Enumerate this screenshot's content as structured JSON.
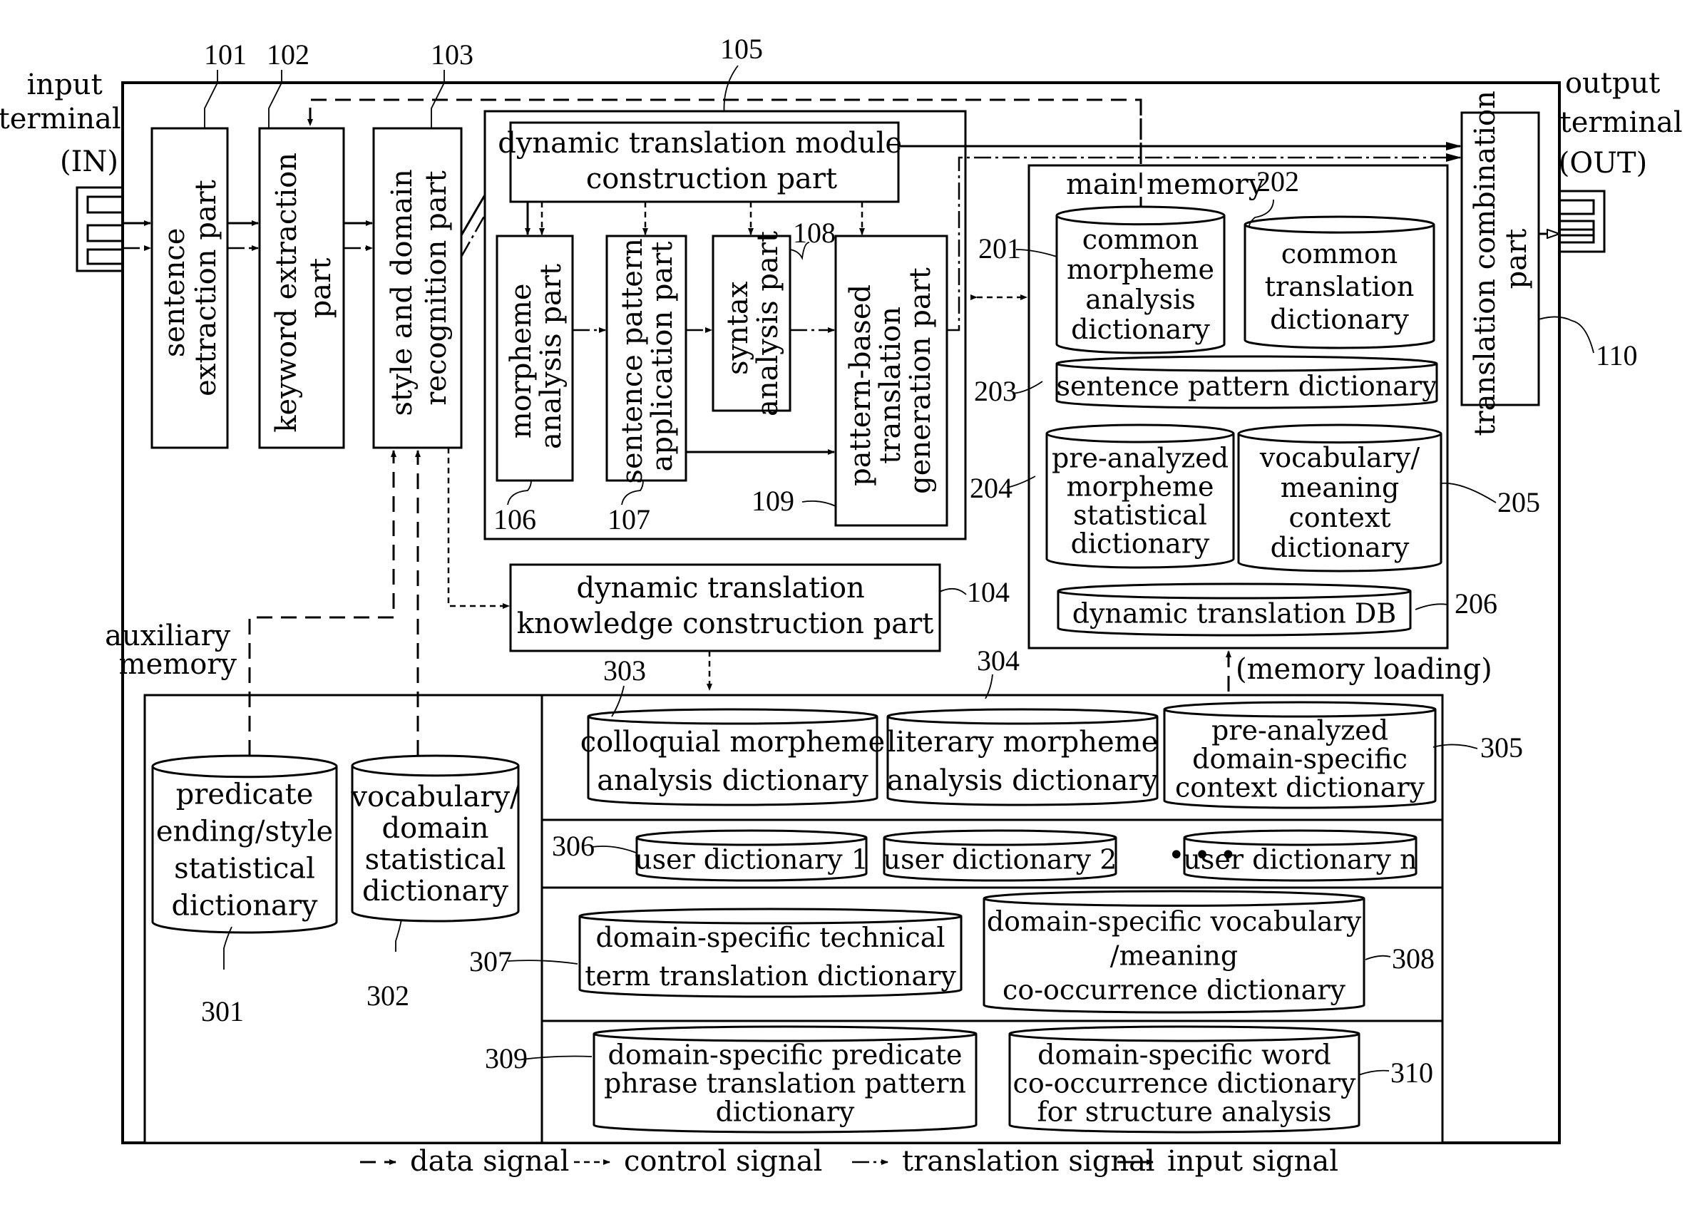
{
  "terminals": {
    "input": [
      "input",
      "terminal",
      "(IN)"
    ],
    "output": [
      "output",
      "terminal",
      "(OUT)"
    ]
  },
  "ref_numbers": {
    "r101": "101",
    "r102": "102",
    "r103": "103",
    "r104": "104",
    "r105": "105",
    "r106": "106",
    "r107": "107",
    "r108": "108",
    "r109": "109",
    "r110": "110",
    "r201": "201",
    "r202": "202",
    "r203": "203",
    "r204": "204",
    "r205": "205",
    "r206": "206",
    "r301": "301",
    "r302": "302",
    "r303": "303",
    "r304": "304",
    "r305": "305",
    "r306": "306",
    "r307": "307",
    "r308": "308",
    "r309": "309",
    "r310": "310"
  },
  "blocks": {
    "sentence_extraction": [
      "sentence",
      "extraction part"
    ],
    "keyword_extraction": [
      "keyword extraction",
      "part"
    ],
    "style_domain": [
      "style and domain",
      "recognition part"
    ],
    "dtm_construction": [
      "dynamic translation module",
      "construction part"
    ],
    "morpheme_analysis": [
      "morpheme",
      "analysis part"
    ],
    "sentence_pattern_app": [
      "sentence pattern",
      "application part"
    ],
    "syntax_analysis": [
      "syntax",
      "analysis part"
    ],
    "pattern_based": [
      "pattern-based",
      "translation",
      "generation part"
    ],
    "dtk_construction": [
      "dynamic translation",
      "knowledge construction part"
    ],
    "translation_combination": [
      "translation combination",
      "part"
    ]
  },
  "main_memory": {
    "title": "main memory",
    "common_morpheme": [
      "common",
      "morpheme",
      "analysis",
      "dictionary"
    ],
    "common_translation": [
      "common",
      "translation",
      "dictionary"
    ],
    "sentence_pattern": [
      "sentence pattern dictionary"
    ],
    "pre_analyzed_morpheme": [
      "pre-analyzed",
      "morpheme",
      "statistical",
      "dictionary"
    ],
    "vocab_meaning_context": [
      "vocabulary/",
      "meaning",
      "context",
      "dictionary"
    ],
    "dynamic_db": [
      "dynamic translation DB"
    ]
  },
  "memory_loading": "(memory loading)",
  "auxiliary_memory": {
    "title": [
      "auxiliary",
      "memory"
    ],
    "predicate_ending": [
      "predicate",
      "ending/style",
      "statistical",
      "dictionary"
    ],
    "vocab_domain": [
      "vocabulary/",
      "domain",
      "statistical",
      "dictionary"
    ],
    "colloquial": [
      "colloquial morpheme",
      "analysis dictionary"
    ],
    "literary": [
      "literary morpheme",
      "analysis dictionary"
    ],
    "pre_analyzed_context": [
      "pre-analyzed",
      "domain-specific",
      "context dictionary"
    ],
    "user_dict_1": [
      "user dictionary 1"
    ],
    "user_dict_2": [
      "user dictionary 2"
    ],
    "ellipsis": "• • •",
    "user_dict_n": [
      "user dictionary n"
    ],
    "technical_term": [
      "domain-specific technical",
      "term translation dictionary"
    ],
    "vocab_cooccurrence": [
      "domain-specific vocabulary",
      "/meaning",
      "co-occurrence dictionary"
    ],
    "predicate_phrase": [
      "domain-specific predicate",
      "phrase translation pattern",
      "dictionary"
    ],
    "word_cooccurrence": [
      "domain-specific word",
      "co-occurrence dictionary",
      "for structure analysis"
    ]
  },
  "legend": [
    {
      "style": "dash",
      "label": "data signal"
    },
    {
      "style": "ctrl",
      "label": "control signal"
    },
    {
      "style": "trans",
      "label": "translation signal"
    },
    {
      "style": "solid",
      "label": "input signal"
    }
  ]
}
